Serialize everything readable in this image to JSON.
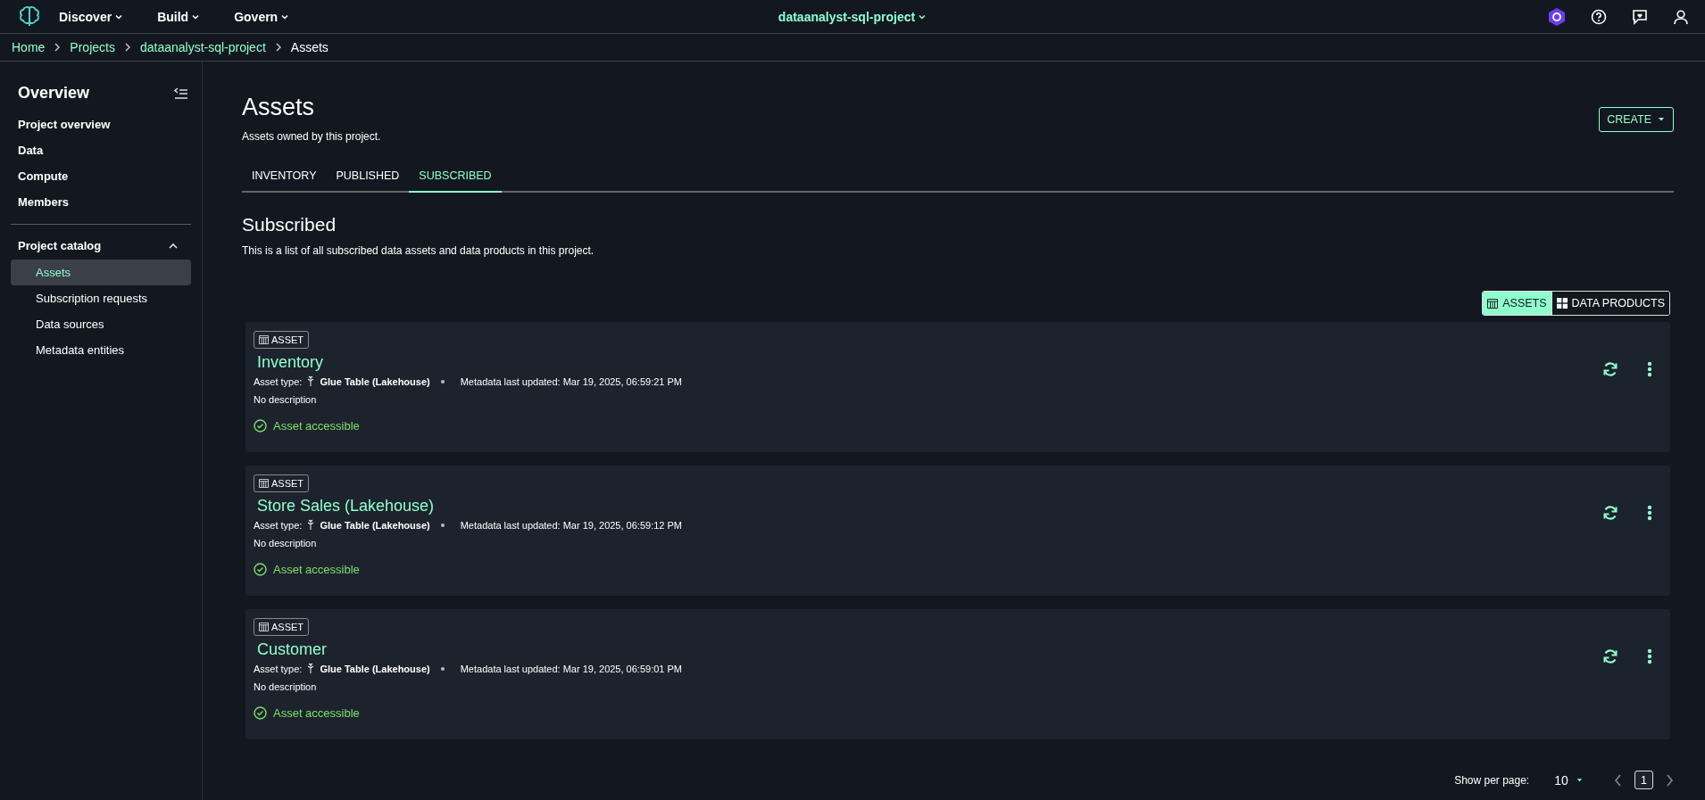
{
  "top_nav": {
    "menus": [
      {
        "label": "Discover"
      },
      {
        "label": "Build"
      },
      {
        "label": "Govern"
      }
    ],
    "project": "dataanalyst-sql-project"
  },
  "breadcrumbs": [
    {
      "label": "Home",
      "link": true
    },
    {
      "label": "Projects",
      "link": true
    },
    {
      "label": "dataanalyst-sql-project",
      "link": true
    },
    {
      "label": "Assets",
      "link": false
    }
  ],
  "sidebar": {
    "title": "Overview",
    "items": [
      {
        "label": "Project overview"
      },
      {
        "label": "Data"
      },
      {
        "label": "Compute"
      },
      {
        "label": "Members"
      }
    ],
    "section": {
      "label": "Project catalog",
      "expanded": true,
      "children": [
        {
          "label": "Assets",
          "selected": true
        },
        {
          "label": "Subscription requests",
          "selected": false
        },
        {
          "label": "Data sources",
          "selected": false
        },
        {
          "label": "Metadata entities",
          "selected": false
        }
      ]
    }
  },
  "page": {
    "title": "Assets",
    "subtitle": "Assets owned by this project.",
    "create_button": "CREATE"
  },
  "tabs": [
    {
      "label": "INVENTORY",
      "selected": false
    },
    {
      "label": "PUBLISHED",
      "selected": false
    },
    {
      "label": "SUBSCRIBED",
      "selected": true
    }
  ],
  "section": {
    "title": "Subscribed",
    "description": "This is a list of all subscribed data assets and data products in this project."
  },
  "view_toggle": [
    {
      "label": "ASSETS",
      "kind": "table",
      "selected": true
    },
    {
      "label": "DATA PRODUCTS",
      "kind": "grid",
      "selected": false
    }
  ],
  "assets": [
    {
      "badge": "ASSET",
      "name": "Inventory",
      "type_label": "Asset type:",
      "type": "Glue Table (Lakehouse)",
      "updated": "Metadata last updated: Mar 19, 2025, 06:59:21 PM",
      "description": "No description",
      "status": "Asset accessible"
    },
    {
      "badge": "ASSET",
      "name": "Store Sales (Lakehouse)",
      "type_label": "Asset type:",
      "type": "Glue Table (Lakehouse)",
      "updated": "Metadata last updated: Mar 19, 2025, 06:59:12 PM",
      "description": "No description",
      "status": "Asset accessible"
    },
    {
      "badge": "ASSET",
      "name": "Customer",
      "type_label": "Asset type:",
      "type": "Glue Table (Lakehouse)",
      "updated": "Metadata last updated: Mar 19, 2025, 06:59:01 PM",
      "description": "No description",
      "status": "Asset accessible"
    }
  ],
  "pagination": {
    "label": "Show per page:",
    "per_page": "10",
    "current_page": "1"
  }
}
